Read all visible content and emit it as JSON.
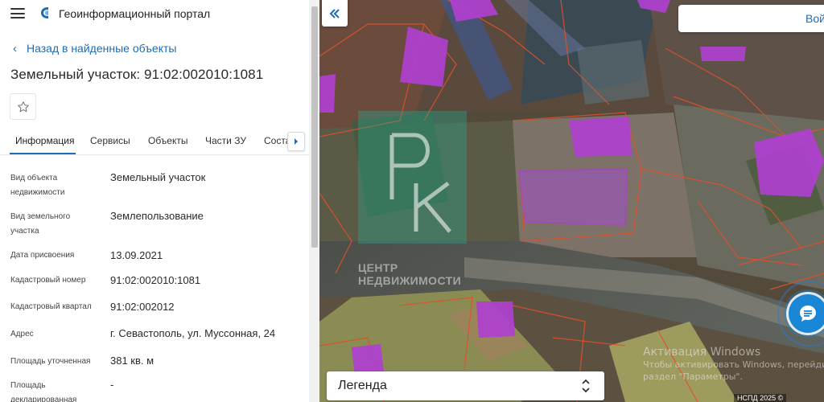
{
  "header": {
    "app_title": "Геоинформационный портал"
  },
  "nav": {
    "back_label": "Назад в найденные объекты"
  },
  "object": {
    "title": "Земельный участок: 91:02:002010:1081"
  },
  "tabs": [
    "Информация",
    "Сервисы",
    "Объекты",
    "Части ЗУ",
    "Соста"
  ],
  "active_tab": "Информация",
  "fields": [
    {
      "label": "Вид объекта недвижимости",
      "value": "Земельный участок"
    },
    {
      "label": "Вид земельного участка",
      "value": "Землепользование"
    },
    {
      "label": "Дата присвоения",
      "value": "13.09.2021"
    },
    {
      "label": "Кадастровый номер",
      "value": "91:02:002010:1081"
    },
    {
      "label": "Кадастровый квартал",
      "value": "91:02:002012"
    },
    {
      "label": "Адрес",
      "value": "г. Севастополь, ул. Муссонная, 24"
    },
    {
      "label": "Площадь уточненная",
      "value": "381 кв. м"
    },
    {
      "label": "Площадь декларированная",
      "value": "-"
    }
  ],
  "map": {
    "login_label": "Вой",
    "watermark_text_line1": "ЦЕНТР",
    "watermark_text_line2": "НЕДВИЖИМОСТИ",
    "legend_label": "Легенда",
    "windows_activation_title": "Активация Windows",
    "windows_activation_line1": "Чтобы активировать Windows, перейдите",
    "windows_activation_line2": "раздел \"Параметры\".",
    "copyright": "НСПД 2025 ©"
  },
  "colors": {
    "accent": "#1f6bb4",
    "parcel_fill": "#b040d0",
    "parcel_border": "#e0502a",
    "chat_button": "#1a86d6"
  },
  "icons": [
    "menu-icon",
    "logo-icon",
    "chevron-left-icon",
    "star-icon",
    "chevron-right-icon",
    "double-chevron-left-icon",
    "chat-icon",
    "up-down-chevron-icon"
  ]
}
